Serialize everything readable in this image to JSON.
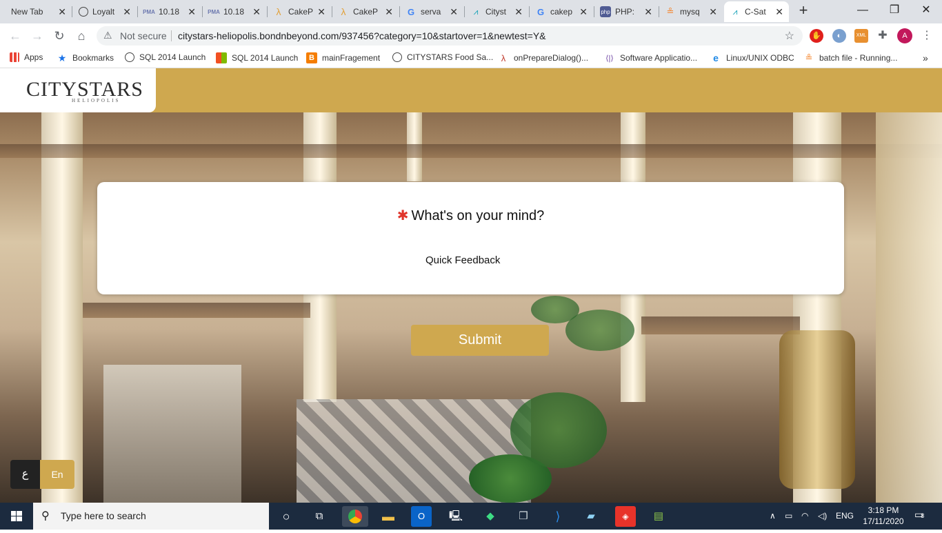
{
  "browser": {
    "tabs": [
      {
        "title": "New Tab"
      },
      {
        "title": "Loyalt"
      },
      {
        "title": "10.18"
      },
      {
        "title": "10.18"
      },
      {
        "title": "CakeP"
      },
      {
        "title": "CakeP"
      },
      {
        "title": "serva"
      },
      {
        "title": "Cityst"
      },
      {
        "title": "cakep"
      },
      {
        "title": "PHP:"
      },
      {
        "title": "mysq"
      },
      {
        "title": "C-Sat"
      }
    ],
    "new_tab": "+",
    "controls": {
      "minimize": "—",
      "maximize": "❐",
      "close": "✕"
    },
    "not_secure": "Not secure",
    "url": "citystars-heliopolis.bondnbeyond.com/937456?category=10&startover=1&newtest=Y&",
    "profile_initial": "A",
    "bookmarks": [
      {
        "label": "Apps"
      },
      {
        "label": "Bookmarks"
      },
      {
        "label": "SQL 2014 Launch"
      },
      {
        "label": "SQL 2014 Launch"
      },
      {
        "label": "mainFragement"
      },
      {
        "label": "CITYSTARS Food Sa..."
      },
      {
        "label": "onPrepareDialog()..."
      },
      {
        "label": "Software Applicatio..."
      },
      {
        "label": "Linux/UNIX ODBC"
      },
      {
        "label": "batch file - Running..."
      }
    ],
    "bookmarks_more": "»"
  },
  "page": {
    "logo": "CITYSTARS",
    "logo_sub": "HELIOPOLIS",
    "required_mark": "✱",
    "question": "What's on your mind?",
    "quick_feedback": "Quick Feedback",
    "submit_label": "Submit",
    "lang_arabic": "ع",
    "lang_english": "En",
    "brand_color": "#cfa84f"
  },
  "taskbar": {
    "search_placeholder": "Type here to search",
    "language": "ENG",
    "time": "3:18 PM",
    "date": "17/11/2020",
    "notifications": "8"
  }
}
